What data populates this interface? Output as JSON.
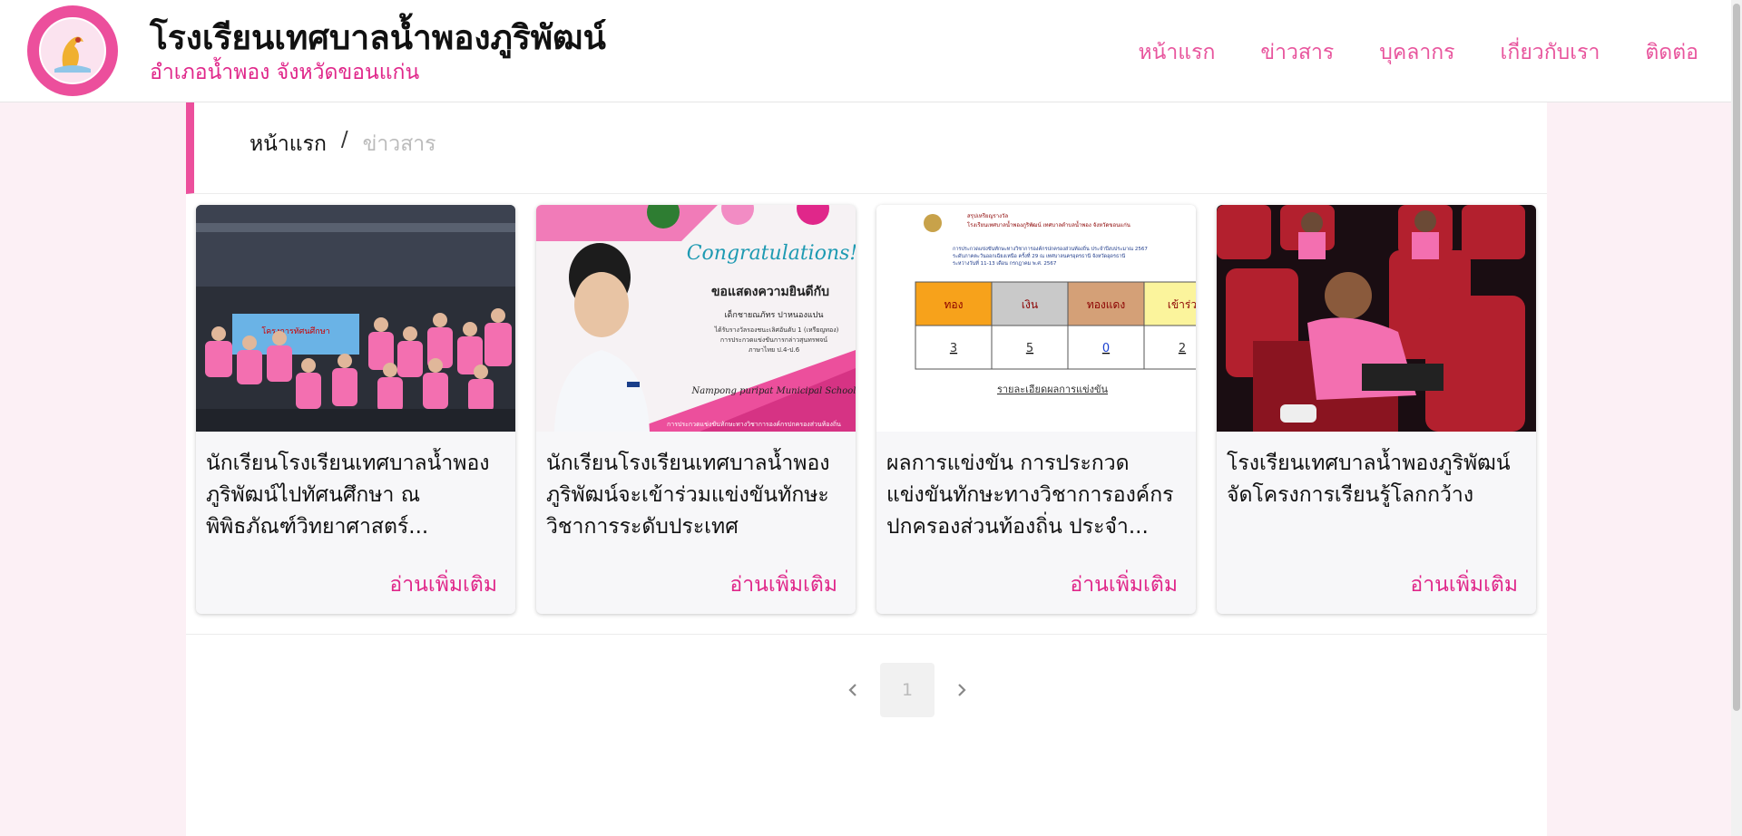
{
  "header": {
    "title": "โรงเรียนเทศบาลน้ำพองภูริพัฒน์",
    "subtitle": "อำเภอน้ำพอง จังหวัดขอนแก่น",
    "logo_icon": "school-seal-logo"
  },
  "nav": {
    "items": [
      {
        "label": "หน้าแรก"
      },
      {
        "label": "ข่าวสาร"
      },
      {
        "label": "บุคลากร"
      },
      {
        "label": "เกี่ยวกับเรา"
      },
      {
        "label": "ติดต่อ"
      }
    ]
  },
  "breadcrumb": {
    "home": "หน้าแรก",
    "separator": "/",
    "current": "ข่าวสาร"
  },
  "cards": [
    {
      "title": "นักเรียนโรงเรียนเทศบาลน้ำพองภูริพัฒน์ไปทัศนศึกษา ณ พิพิธภัณฑ์วิทยาศาสตร์...",
      "read_more": "อ่านเพิ่มเติม",
      "image": "group-photo-students"
    },
    {
      "title": "นักเรียนโรงเรียนเทศบาลน้ำพองภูริพัฒน์จะเข้าร่วมแข่งขันทักษะวิชาการระดับประเทศ",
      "read_more": "อ่านเพิ่มเติม",
      "image": "congratulations-poster"
    },
    {
      "title": "ผลการแข่งขัน การประกวดแข่งขันทักษะทางวิชาการองค์กรปกครองส่วนท้องถิ่น ประจำ...",
      "read_more": "อ่านเพิ่มเติม",
      "image": "medal-results-table"
    },
    {
      "title": "โรงเรียนเทศบาลน้ำพองภูริพัฒน์จัดโครงการเรียนรู้โลกกว้าง",
      "read_more": "อ่านเพิ่มเติม",
      "image": "student-cinema-seat"
    }
  ],
  "results_table": {
    "headers": [
      "ทอง",
      "เงิน",
      "ทองแดง",
      "เข้าร่ว"
    ],
    "values": [
      "3",
      "5",
      "0",
      "2"
    ],
    "link": "รายละเอียดผลการแข่งขัน",
    "heading1": "สรุปเหรียญรางวัล",
    "heading2": "โรงเรียนเทศบาลน้ำพองภูริพัฒน์ เทศบาลตำบลน้ำพอง จังหวัดขอนแก่น",
    "info1": "การประกวดแข่งขันทักษะทางวิชาการองค์กรปกครองส่วนท้องถิ่น ประจำปีงบประมาณ 2567",
    "info2": "ระดับภาคตะวันออกเฉียงเหนือ ครั้งที่ 29 ณ เทศบาลนครอุดรธานี จังหวัดอุดรธานี",
    "info3": "ระหว่างวันที่ 11-13 เดือน กรกฎาคม พ.ศ. 2567",
    "colors": [
      "#f7a21b",
      "#c9c9c9",
      "#d4a077",
      "#fbf49c"
    ]
  },
  "poster": {
    "congrats": "Congratulations!",
    "heading": "ขอแสดงความยินดีกับ",
    "name": "เด็กชายณภัทร ปาหนองแปน",
    "line1": "ได้รับรางวัลรองชนะเลิศอันดับ 1 (เหรียญทอง)",
    "line2": "การประกวดแข่งขันการกล่าวสุนทรพจน์",
    "line3": "ภาษาไทย ป.4-ป.6",
    "school_en": "Nampong puripat Municipal School",
    "banner_text": "การประกวดแข่งขันทักษะทางวิชาการองค์กรปกครองส่วนท้องถิ่น"
  },
  "group_photo": {
    "banner_text": "โครงการทัศนศึกษา"
  },
  "pagination": {
    "prev_icon": "chevron-left-icon",
    "current_page": "1",
    "next_icon": "chevron-right-icon"
  },
  "colors": {
    "accent": "#e0278a",
    "nav_link": "#e8559d",
    "page_bg": "#fcf0f5",
    "border_accent": "#ec4f9c"
  }
}
